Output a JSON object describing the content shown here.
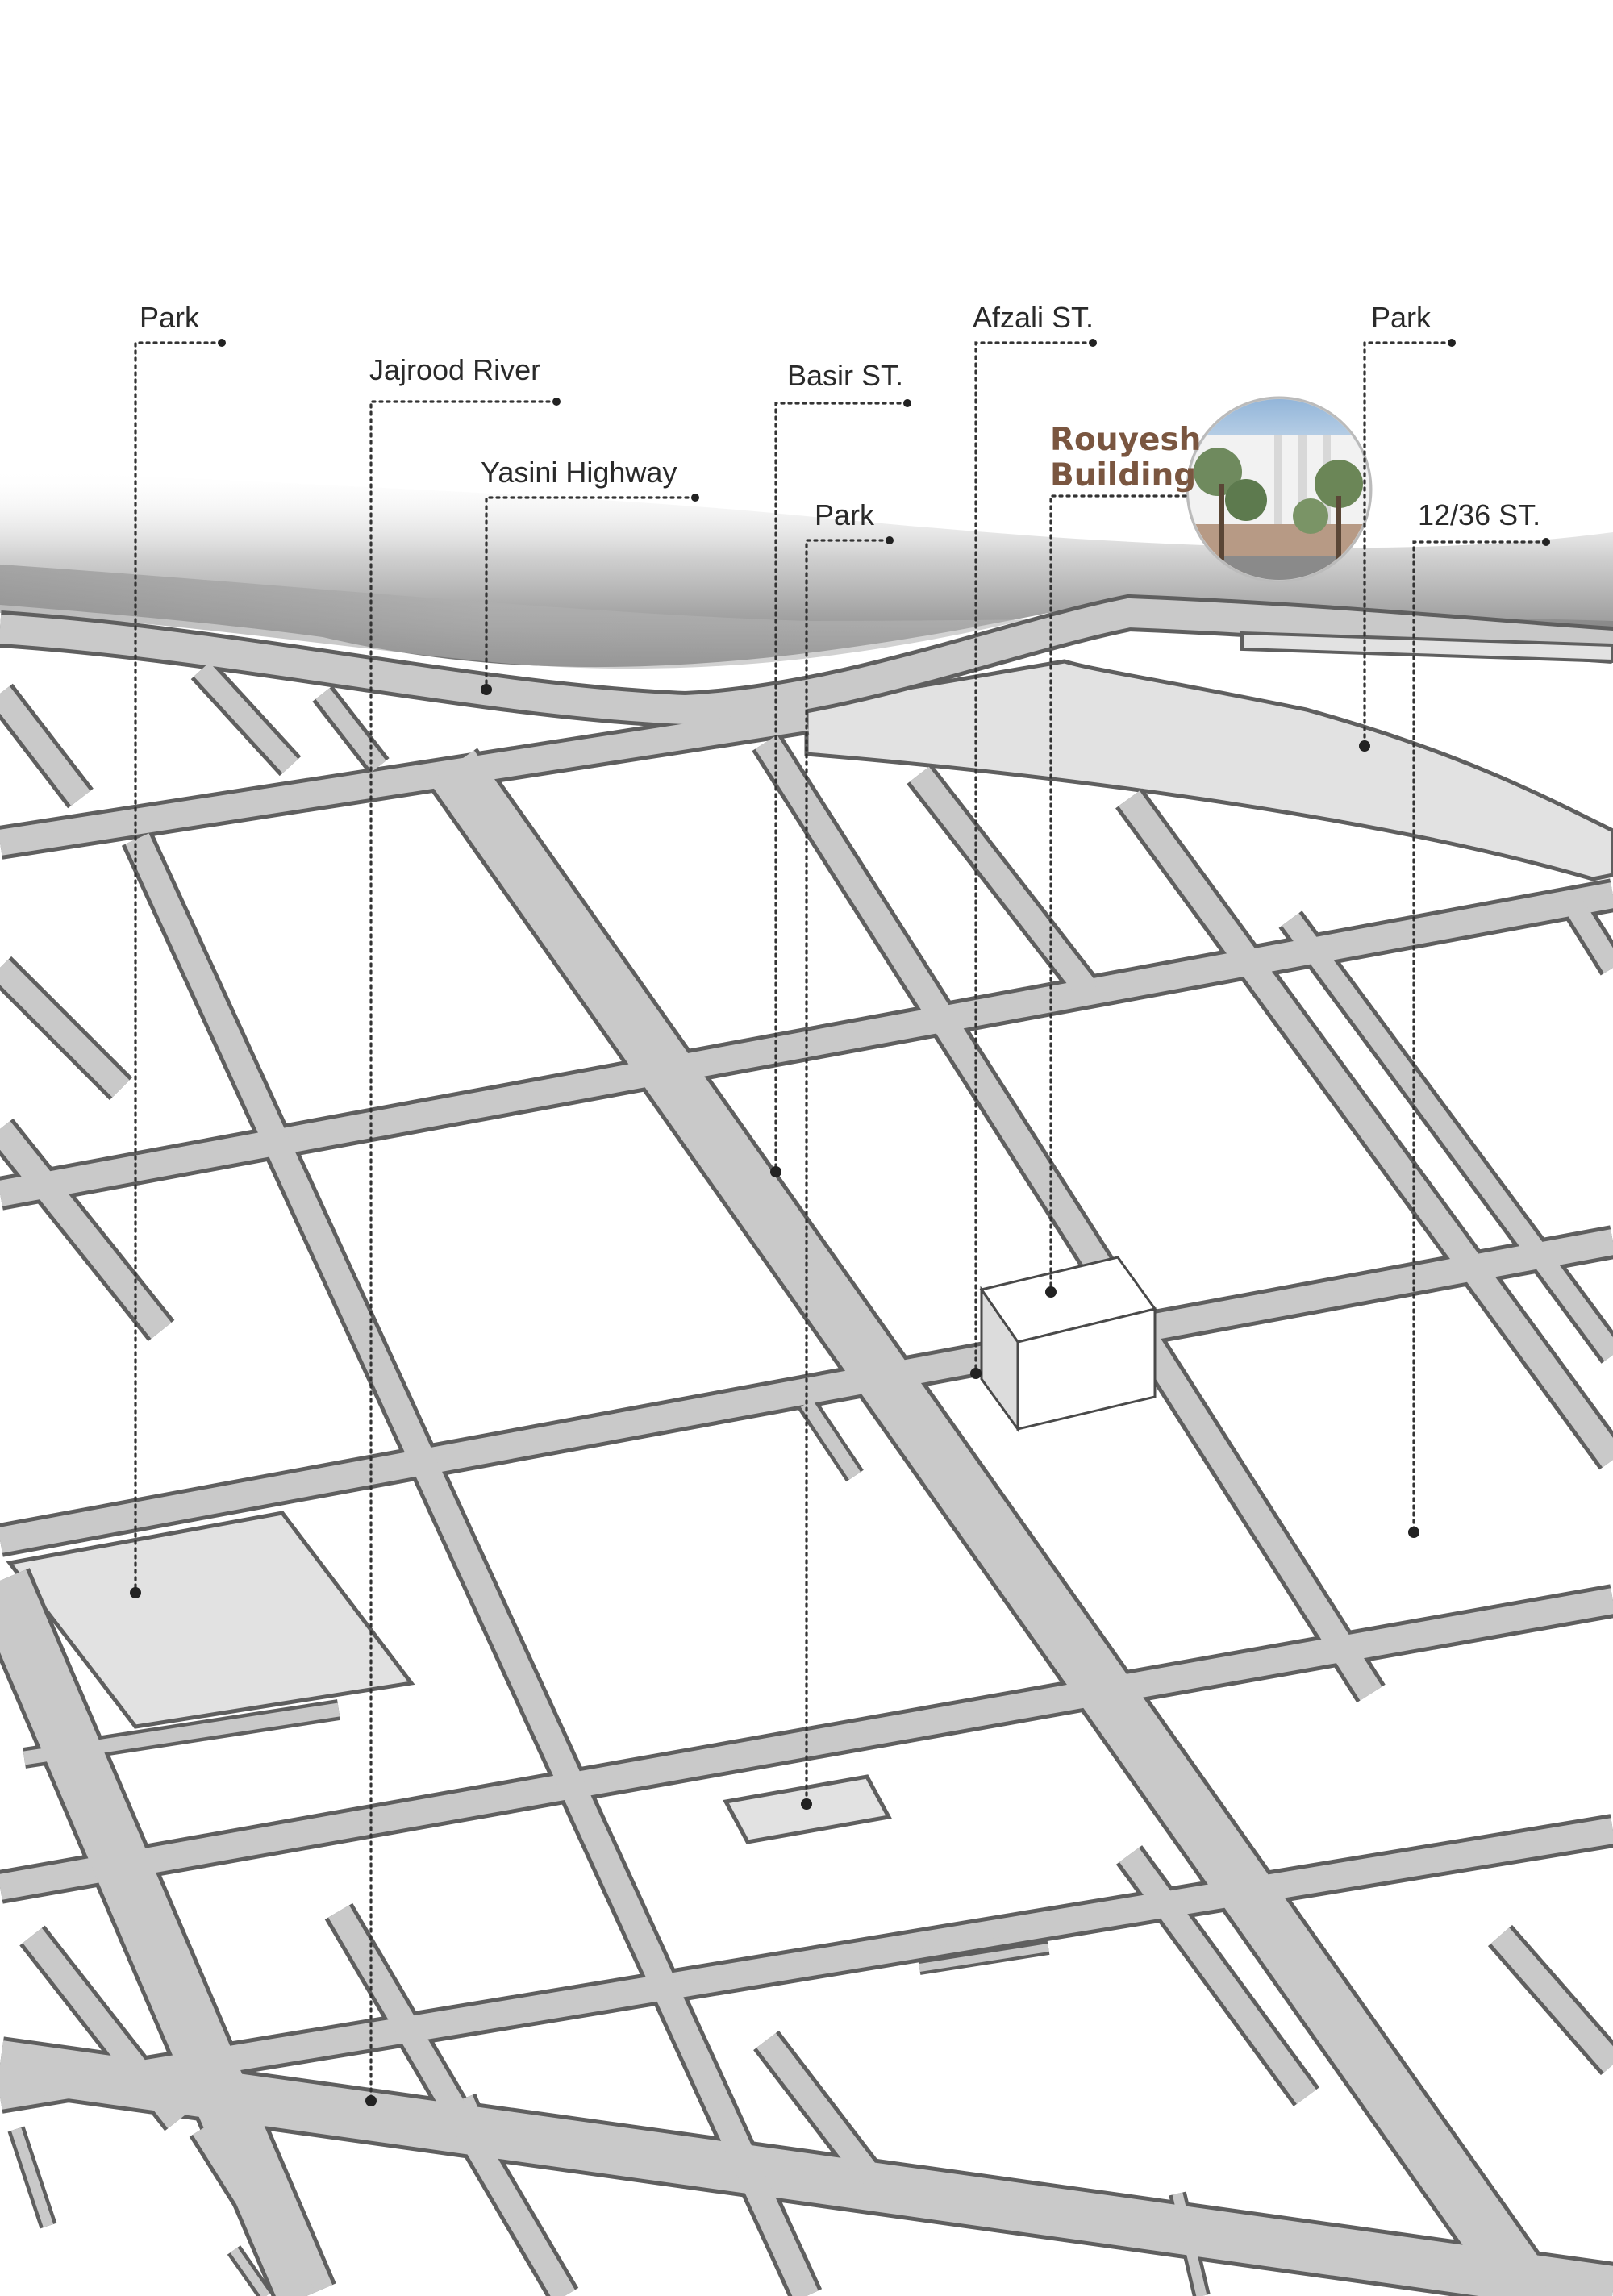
{
  "labels": {
    "park_west": "Park",
    "jajrood_river": "Jajrood River",
    "yasini_highway": "Yasini Highway",
    "basir_st": "Basir ST.",
    "park_center": "Park",
    "afzali_st": "Afzali ST.",
    "park_east": "Park",
    "street_12_36": "12/36 ST."
  },
  "building": {
    "name_line1": "Rouyesh",
    "name_line2": "Building",
    "label_color": "#7a5640"
  },
  "colors": {
    "road_fill": "#c9c9c9",
    "road_outline": "#5f5f5f",
    "park_fill": "#e2e2e2",
    "river_shadow": "#8a8a8a",
    "block_fill": "#ffffff"
  },
  "icons": [
    "building-photo-circle",
    "building-block-3d"
  ]
}
